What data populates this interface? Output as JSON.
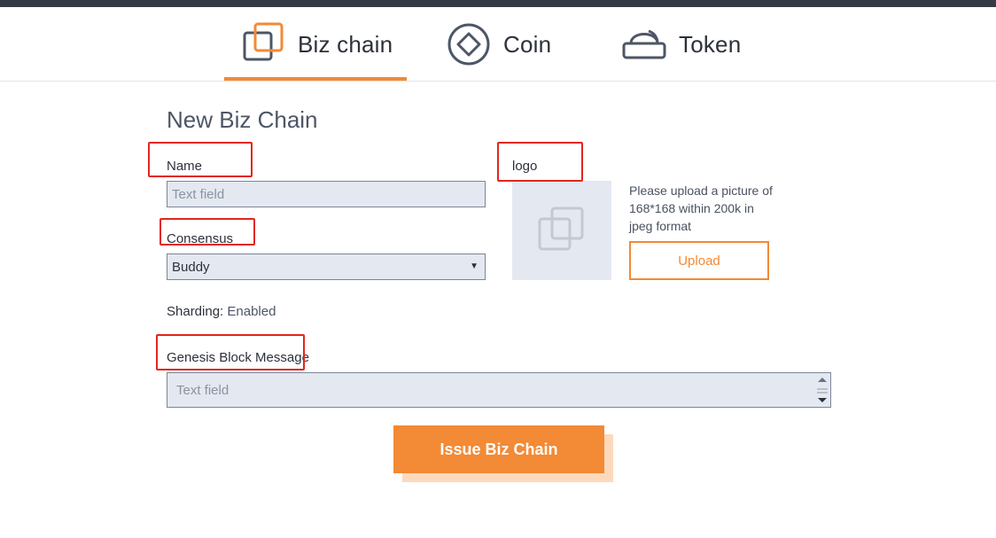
{
  "tabs": [
    {
      "label": "Biz chain",
      "icon": "biz-chain-icon",
      "active": true
    },
    {
      "label": "Coin",
      "icon": "coin-icon",
      "active": false
    },
    {
      "label": "Token",
      "icon": "token-icon",
      "active": false
    }
  ],
  "form": {
    "title": "New Biz Chain",
    "name_label": "Name",
    "name_placeholder": "Text field",
    "consensus_label": "Consensus",
    "consensus_value": "Buddy",
    "sharding_label": "Sharding:",
    "sharding_value": "Enabled",
    "genesis_label": "Genesis Block Message",
    "genesis_placeholder": "Text field",
    "logo_label": "logo",
    "upload_hint": "Please upload a picture of 168*168 within 200k in jpeg format",
    "upload_label": "Upload",
    "submit_label": "Issue Biz Chain"
  },
  "colors": {
    "accent": "#f28a36",
    "highlight_box": "#e3261d",
    "field_bg": "#e4e8f0",
    "topbar": "#353b45"
  }
}
